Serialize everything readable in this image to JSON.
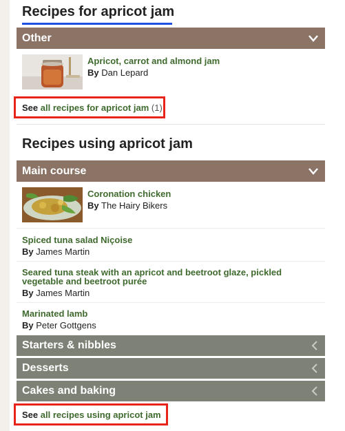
{
  "section1": {
    "title": "Recipes for apricot jam",
    "category": "Other",
    "recipe": {
      "title": "Apricot, carrot and almond jam",
      "by": "By",
      "author": "Dan Lepard"
    },
    "see_all": {
      "prefix": "See",
      "link": "all recipes for apricot jam",
      "count": "(1)"
    }
  },
  "section2": {
    "title": "Recipes using apricot jam",
    "category": "Main course",
    "recipes": [
      {
        "title": "Coronation chicken",
        "by": "By",
        "author": "The Hairy Bikers"
      },
      {
        "title": "Spiced tuna salad Niçoise",
        "by": "By",
        "author": "James Martin"
      },
      {
        "title": "Seared tuna steak with an apricot and beetroot glaze, pickled",
        "title2": "vegetable and beetroot purée",
        "by": "By",
        "author": "James Martin"
      },
      {
        "title": "Marinated lamb",
        "by": "By",
        "author": "Peter Gottgens"
      }
    ],
    "collapsed": [
      {
        "label": "Starters & nibbles"
      },
      {
        "label": "Desserts"
      },
      {
        "label": "Cakes and baking"
      }
    ],
    "see_all": {
      "prefix": "See",
      "link": "all recipes using apricot jam"
    }
  },
  "colors": {
    "accent_brown": "#8b7466",
    "accent_gray": "#7d8176",
    "link_green": "#3f6a2e",
    "highlight_red": "#e8231a",
    "underline_blue": "#1f4fe0"
  },
  "icons": {
    "expanded": "chevron-down-icon",
    "collapsed": "chevron-left-icon"
  }
}
